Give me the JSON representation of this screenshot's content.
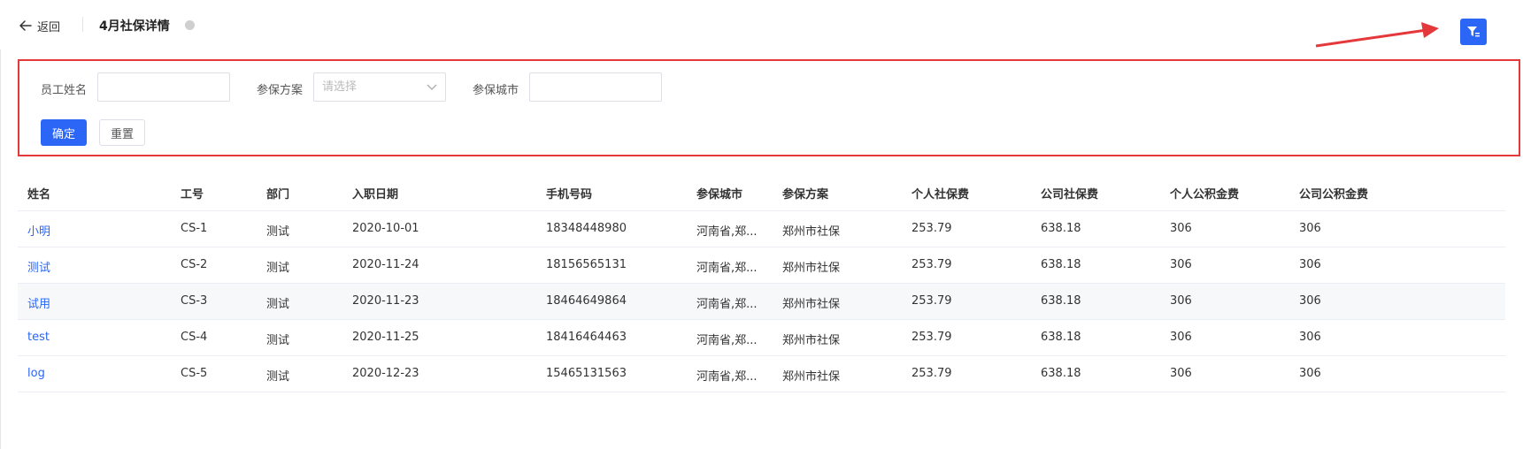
{
  "header": {
    "back_label": "返回",
    "title": "4月社保详情"
  },
  "icons": {
    "back": "arrow-left-icon",
    "filter": "filter-icon",
    "select_caret": "chevron-down-icon"
  },
  "colors": {
    "primary": "#2b66f6",
    "highlight_border": "#e5383b",
    "annotation_arrow": "#e5383b",
    "status_dot": "#cfcfcf"
  },
  "filter": {
    "employee_name_label": "员工姓名",
    "employee_name_value": "",
    "plan_label": "参保方案",
    "plan_placeholder": "请选择",
    "city_label": "参保城市",
    "city_value": "",
    "confirm_label": "确定",
    "reset_label": "重置"
  },
  "table": {
    "columns": [
      "姓名",
      "工号",
      "部门",
      "入职日期",
      "手机号码",
      "参保城市",
      "参保方案",
      "个人社保费",
      "公司社保费",
      "个人公积金费",
      "公司公积金费"
    ],
    "rows": [
      {
        "name": "小明",
        "id": "CS-1",
        "dept": "测试",
        "hire_date": "2020-10-01",
        "phone": "18348448980",
        "city": "河南省,郑...",
        "plan": "郑州市社保",
        "personal_si": "253.79",
        "company_si": "638.18",
        "personal_hf": "306",
        "company_hf": "306"
      },
      {
        "name": "测试",
        "id": "CS-2",
        "dept": "测试",
        "hire_date": "2020-11-24",
        "phone": "18156565131",
        "city": "河南省,郑...",
        "plan": "郑州市社保",
        "personal_si": "253.79",
        "company_si": "638.18",
        "personal_hf": "306",
        "company_hf": "306"
      },
      {
        "name": "试用",
        "id": "CS-3",
        "dept": "测试",
        "hire_date": "2020-11-23",
        "phone": "18464649864",
        "city": "河南省,郑...",
        "plan": "郑州市社保",
        "personal_si": "253.79",
        "company_si": "638.18",
        "personal_hf": "306",
        "company_hf": "306"
      },
      {
        "name": "test",
        "id": "CS-4",
        "dept": "测试",
        "hire_date": "2020-11-25",
        "phone": "18416464463",
        "city": "河南省,郑...",
        "plan": "郑州市社保",
        "personal_si": "253.79",
        "company_si": "638.18",
        "personal_hf": "306",
        "company_hf": "306"
      },
      {
        "name": "log",
        "id": "CS-5",
        "dept": "测试",
        "hire_date": "2020-12-23",
        "phone": "15465131563",
        "city": "河南省,郑...",
        "plan": "郑州市社保",
        "personal_si": "253.79",
        "company_si": "638.18",
        "personal_hf": "306",
        "company_hf": "306"
      }
    ]
  }
}
